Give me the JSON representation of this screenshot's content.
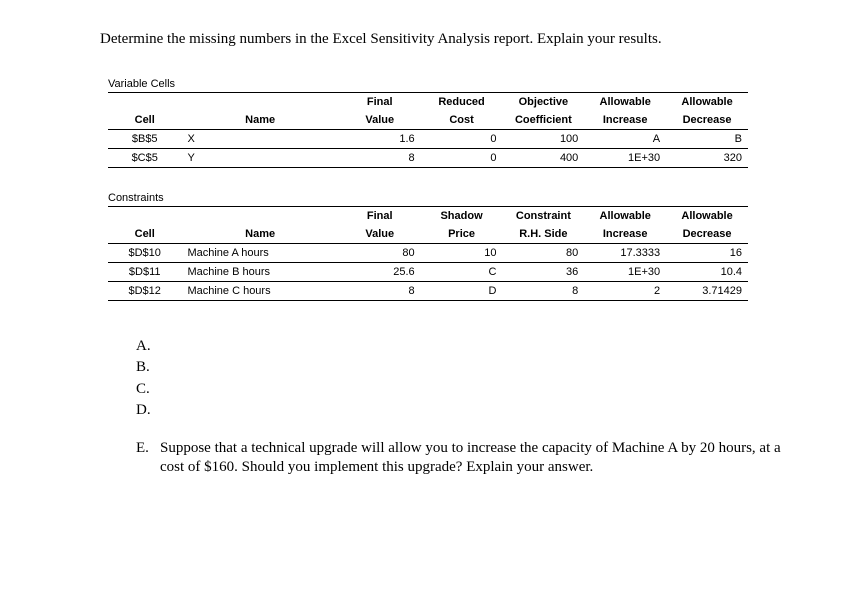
{
  "intro": "Determine the missing numbers in the Excel Sensitivity Analysis report. Explain your results.",
  "var_section": {
    "label": "Variable Cells",
    "headers_top": [
      "",
      "",
      "Final",
      "Reduced",
      "Objective",
      "Allowable",
      "Allowable"
    ],
    "headers_bot": [
      "Cell",
      "Name",
      "Value",
      "Cost",
      "Coefficient",
      "Increase",
      "Decrease"
    ],
    "rows": [
      {
        "cell": "$B$5",
        "name": "X",
        "final": "1.6",
        "reduced": "0",
        "obj": "100",
        "inc": "A",
        "dec": "B"
      },
      {
        "cell": "$C$5",
        "name": "Y",
        "final": "8",
        "reduced": "0",
        "obj": "400",
        "inc": "1E+30",
        "dec": "320"
      }
    ]
  },
  "con_section": {
    "label": "Constraints",
    "headers_top": [
      "",
      "",
      "Final",
      "Shadow",
      "Constraint",
      "Allowable",
      "Allowable"
    ],
    "headers_bot": [
      "Cell",
      "Name",
      "Value",
      "Price",
      "R.H. Side",
      "Increase",
      "Decrease"
    ],
    "rows": [
      {
        "cell": "$D$10",
        "name": "Machine A hours",
        "final": "80",
        "shadow": "10",
        "rh": "80",
        "inc": "17.3333",
        "dec": "16"
      },
      {
        "cell": "$D$11",
        "name": "Machine B hours",
        "final": "25.6",
        "shadow": "C",
        "rh": "36",
        "inc": "1E+30",
        "dec": "10.4"
      },
      {
        "cell": "$D$12",
        "name": "Machine C hours",
        "final": "8",
        "shadow": "D",
        "rh": "8",
        "inc": "2",
        "dec": "3.71429"
      }
    ]
  },
  "questions": {
    "a": "A.",
    "b": "B.",
    "c": "C.",
    "d": "D.",
    "e_letter": "E.",
    "e_text": "Suppose that a technical upgrade will allow you to increase the capacity of Machine A by 20 hours, at a cost of $160. Should you implement this upgrade? Explain your answer."
  }
}
